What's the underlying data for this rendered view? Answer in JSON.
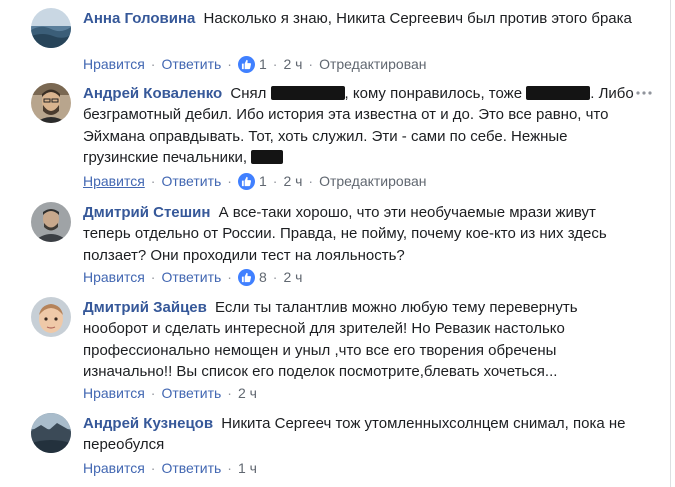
{
  "comments": [
    {
      "name": "Анна Головина",
      "text": "Насколько я знаю, Никита Сергеевич был против этого брака",
      "like": "Нравится",
      "reply": "Ответить",
      "likes": "1",
      "time": "2 ч",
      "edited": "Отредактирован"
    },
    {
      "name": "Андрей Коваленко",
      "text_a": "Снял",
      "text_b": ", кому понравилось, тоже",
      "text_c": ". Либо безграмотный дебил. Ибо история эта известна от и до. Это все равно, что Эйхмана оправдывать. Тот, хоть служил. Эти - сами по себе. Нежные грузинские печальники,",
      "like": "Нравится",
      "reply": "Ответить",
      "likes": "1",
      "time": "2 ч",
      "edited": "Отредактирован"
    },
    {
      "name": "Дмитрий Стешин",
      "text": "А все-таки хорошо, что эти необучаемые мрази живут теперь отдельно от России. Правда, не пойму, почему кое-кто из них здесь ползает? Они проходили тест на лояльность?",
      "like": "Нравится",
      "reply": "Ответить",
      "likes": "8",
      "time": "2 ч"
    },
    {
      "name": "Дмитрий Зайцев",
      "text": "Если ты талантлив можно любую тему перевернуть нооборот и сделать интересной для зрителей! Но Ревазик настолько профессионально немощен и уныл ,что все его творения обречены изначально!! Вы список его поделок посмотрите,блевать хочеться...",
      "like": "Нравится",
      "reply": "Ответить",
      "time": "2 ч"
    },
    {
      "name": "Андрей Кузнецов",
      "text": "Никита Сергееч тож утомленныхсолнцем снимал, пока не переобулся",
      "like": "Нравится",
      "reply": "Ответить",
      "time": "1 ч"
    }
  ],
  "separator": "·",
  "colors": {
    "name": "#365899",
    "link": "#4267b2",
    "meta": "#606770",
    "like_badge": "#4080ff"
  },
  "icons": {
    "like": "thumbs-up-icon",
    "menu": "more-dots-icon"
  }
}
